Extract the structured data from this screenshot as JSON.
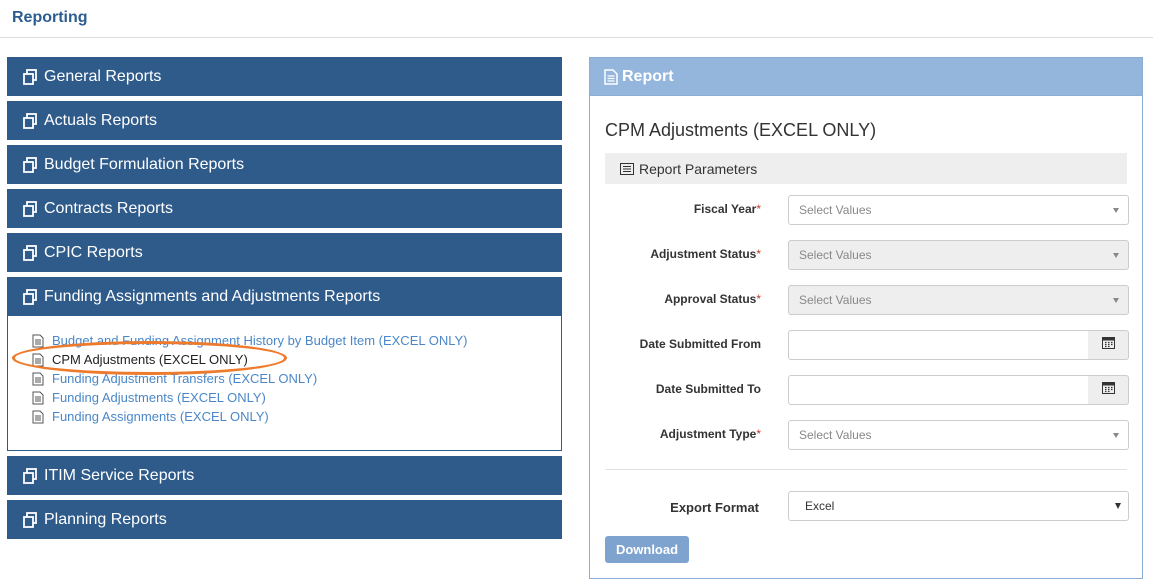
{
  "header": {
    "title": "Reporting"
  },
  "accordion": {
    "sections_top": [
      {
        "label": "General Reports"
      },
      {
        "label": "Actuals Reports"
      },
      {
        "label": "Budget Formulation Reports"
      },
      {
        "label": "Contracts Reports"
      },
      {
        "label": "CPIC Reports"
      }
    ],
    "open_section": {
      "label": "Funding Assignments and Adjustments Reports",
      "items": [
        {
          "label": "Budget and Funding Assignment History by Budget Item (EXCEL ONLY)"
        },
        {
          "label": "CPM Adjustments (EXCEL ONLY)",
          "active": true
        },
        {
          "label": "Funding Adjustment Transfers (EXCEL ONLY)"
        },
        {
          "label": "Funding Adjustments (EXCEL ONLY)"
        },
        {
          "label": "Funding Assignments (EXCEL ONLY)"
        }
      ]
    },
    "sections_bottom": [
      {
        "label": "ITIM Service Reports"
      },
      {
        "label": "Planning Reports"
      }
    ]
  },
  "report_panel": {
    "header": "Report",
    "title": "CPM Adjustments (EXCEL ONLY)",
    "params_header": "Report Parameters",
    "fields": {
      "fiscal_year": {
        "label": "Fiscal Year",
        "required": "*",
        "placeholder": "Select Values"
      },
      "adjustment_status": {
        "label": "Adjustment Status",
        "required": "*",
        "placeholder": "Select Values"
      },
      "approval_status": {
        "label": "Approval Status",
        "required": "*",
        "placeholder": "Select Values"
      },
      "date_from": {
        "label": "Date Submitted From",
        "value": ""
      },
      "date_to": {
        "label": "Date Submitted To",
        "value": ""
      },
      "adjustment_type": {
        "label": "Adjustment Type",
        "required": "*",
        "placeholder": "Select Values"
      }
    },
    "export_format": {
      "label": "Export Format",
      "value": "Excel"
    },
    "download_label": "Download"
  },
  "colors": {
    "accordion_header": "#2f5b8b",
    "panel_header": "#95b6dc",
    "link": "#4a87c8",
    "highlight_oval": "#ee7a2c",
    "download_button": "#7fa3cf"
  }
}
